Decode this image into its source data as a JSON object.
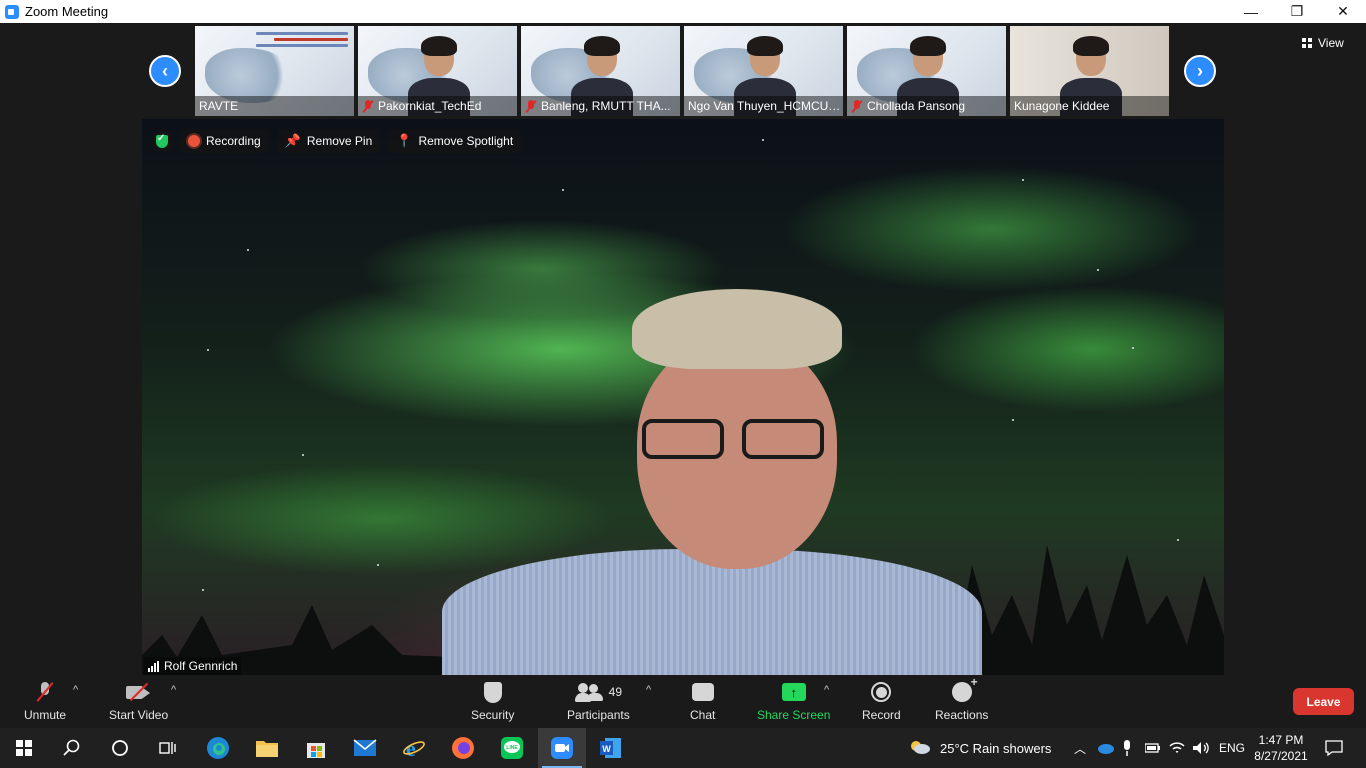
{
  "window": {
    "title": "Zoom Meeting",
    "controls": {
      "minimize": "—",
      "restore": "❐",
      "close": "✕"
    }
  },
  "gallery": {
    "view_label": "View",
    "prev_arrow": "‹",
    "next_arrow": "›",
    "thumbnails": [
      {
        "name": "RAVTE",
        "muted": false,
        "kind": "slide"
      },
      {
        "name": "Pakornkiat_TechEd",
        "muted": true,
        "kind": "slide-person"
      },
      {
        "name": "Banleng, RMUTT THA...",
        "muted": true,
        "kind": "slide-person"
      },
      {
        "name": "Ngo Van Thuyen_HCMCUTE",
        "muted": false,
        "kind": "slide-person"
      },
      {
        "name": "Chollada Pansong",
        "muted": true,
        "kind": "slide-person"
      },
      {
        "name": "Kunagone Kiddee",
        "muted": false,
        "kind": "camera"
      }
    ]
  },
  "main": {
    "speaker_name": "Rolf Gennrich",
    "overlay": {
      "recording_label": "Recording",
      "remove_pin_label": "Remove Pin",
      "remove_spotlight_label": "Remove Spotlight"
    }
  },
  "toolbar": {
    "unmute_label": "Unmute",
    "start_video_label": "Start Video",
    "security_label": "Security",
    "participants_label": "Participants",
    "participants_count": "49",
    "chat_label": "Chat",
    "share_screen_label": "Share Screen",
    "record_label": "Record",
    "reactions_label": "Reactions",
    "leave_label": "Leave",
    "caret": "^",
    "share_arrow": "↑"
  },
  "taskbar": {
    "weather": "25°C  Rain showers",
    "language": "ENG",
    "time": "1:47 PM",
    "date": "8/27/2021",
    "line_app": "LINE",
    "word_app": "W"
  },
  "colors": {
    "zoom_blue": "#2d8cff",
    "share_green": "#23d85b",
    "leave_red": "#d9362f",
    "muted_red": "#e02828"
  }
}
